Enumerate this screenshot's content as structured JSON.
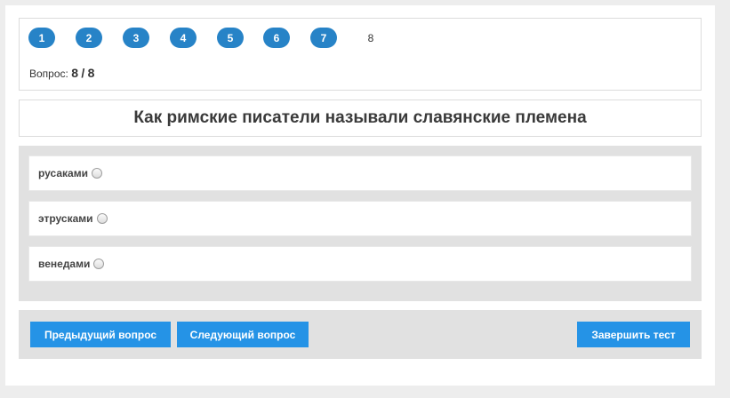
{
  "navigation": {
    "questions": [
      {
        "number": "1",
        "answered": true
      },
      {
        "number": "2",
        "answered": true
      },
      {
        "number": "3",
        "answered": true
      },
      {
        "number": "4",
        "answered": true
      },
      {
        "number": "5",
        "answered": true
      },
      {
        "number": "6",
        "answered": true
      },
      {
        "number": "7",
        "answered": true
      },
      {
        "number": "8",
        "answered": false,
        "current": true
      }
    ],
    "counter_label": "Вопрос:",
    "current": "8",
    "separator": "/",
    "total": "8"
  },
  "question": {
    "title": "Как римские писатели называли славянские племена",
    "answers": [
      {
        "label": "русаками",
        "selected": false
      },
      {
        "label": "этрусками",
        "selected": false
      },
      {
        "label": "венедами",
        "selected": false
      }
    ]
  },
  "footer": {
    "prev_label": "Предыдущий вопрос",
    "next_label": "Следующий вопрос",
    "finish_label": "Завершить тест"
  },
  "colors": {
    "accent": "#2593e6",
    "pill": "#2783c7",
    "panel": "#e1e1e1",
    "background": "#ededed"
  }
}
